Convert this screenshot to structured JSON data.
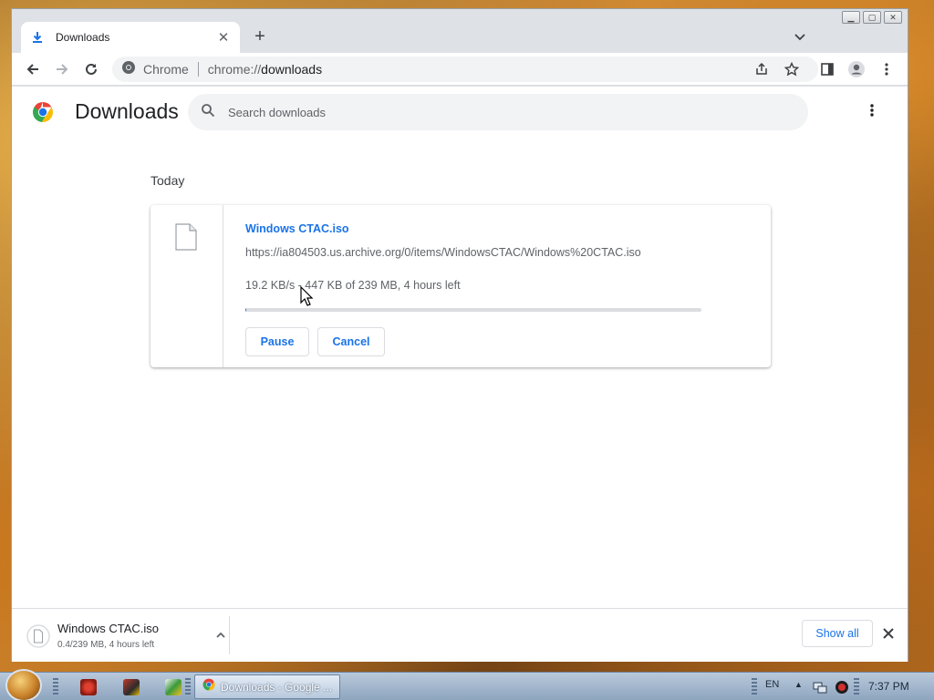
{
  "window": {
    "tab_title": "Downloads",
    "address_site": "Chrome",
    "address_scheme": "chrome://",
    "address_path": "downloads"
  },
  "page": {
    "title": "Downloads",
    "search_placeholder": "Search downloads",
    "date_group": "Today"
  },
  "download": {
    "file_name": "Windows CTAC.iso",
    "url": "https://ia804503.us.archive.org/0/items/WindowsCTAC/Windows%20CTAC.iso",
    "status": "19.2 KB/s - 447 KB of 239 MB, 4 hours left",
    "progress_fraction": 0.002,
    "pause_label": "Pause",
    "cancel_label": "Cancel"
  },
  "shelf": {
    "file_name": "Windows CTAC.iso",
    "status": "0.4/239 MB, 4 hours left",
    "show_all_label": "Show all"
  },
  "taskbar": {
    "task_label": "Downloads - Google ...",
    "language": "EN",
    "clock": "7:37 PM"
  },
  "colors": {
    "accent": "#1a73e8",
    "text_primary": "#202124",
    "text_secondary": "#5f6368"
  }
}
